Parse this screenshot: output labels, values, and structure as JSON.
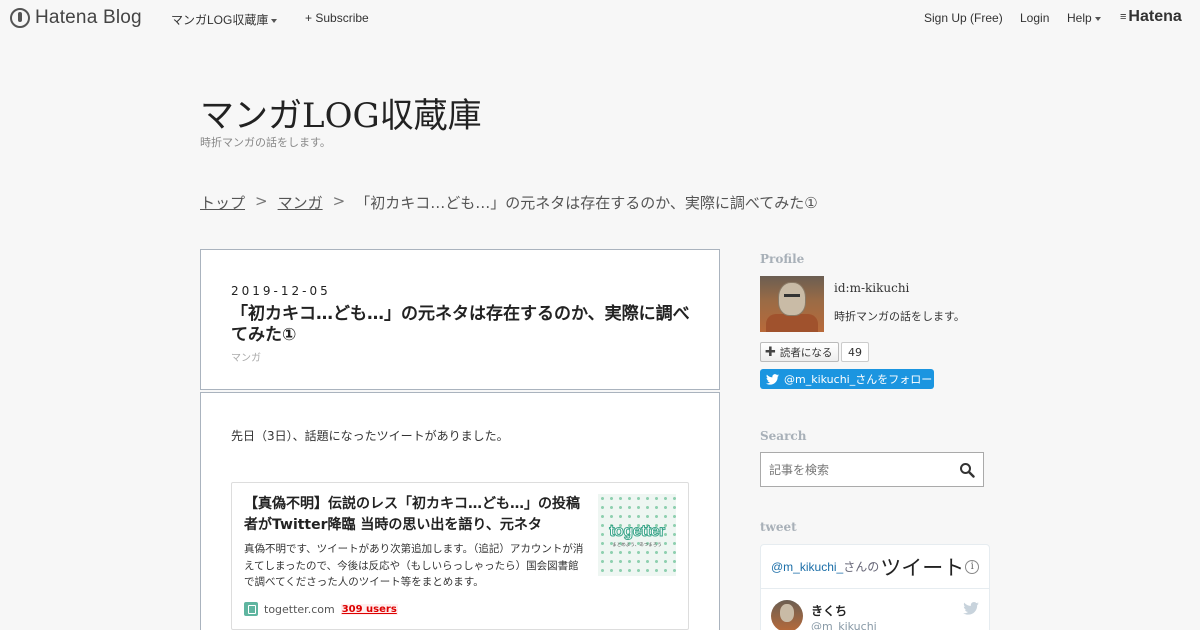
{
  "topbar": {
    "logo_text": "Hatena Blog",
    "blog_menu": "マンガLOG収蔵庫",
    "subscribe": "+ Subscribe",
    "signup": "Sign Up (Free)",
    "login": "Login",
    "help": "Help",
    "hatena": "Hatena"
  },
  "blog": {
    "title": "マンガLOG収蔵庫",
    "description": "時折マンガの話をします。"
  },
  "breadcrumb": {
    "top": "トップ",
    "sep1": ">",
    "category": "マンガ",
    "sep2": ">",
    "current": "「初カキコ…ども…」の元ネタは存在するのか、実際に調べてみた①"
  },
  "entry": {
    "date": "2019-12-05",
    "title": "「初カキコ…ども…」の元ネタは存在するのか、実際に調べてみた①",
    "category": "マンガ",
    "intro": "先日（3日）、話題になったツイートがありました。"
  },
  "embed": {
    "title": "【真偽不明】伝説のレス「初カキコ…ども…」の投稿者がTwitter降臨 当時の思い出を語り、元ネタ",
    "description": "真偽不明です、ツイートがあり次第追加します。（追記）アカウントが消えてしまったので、今後は反応や（もしいらっしゃったら）国会図書館で調べてくださった人のツイート等をまとめます。",
    "thumb_logo": "togetter",
    "thumb_sub": "まとめよう、あつまろう",
    "site": "togetter.com",
    "users": "309 users"
  },
  "sidebar": {
    "profile_heading": "Profile",
    "profile_id": "id:m-kikuchi",
    "profile_desc": "時折マンガの話をします。",
    "reader_button": "読者になる",
    "reader_count": "49",
    "follow_button": "@m_kikuchi_さんをフォロー",
    "search_heading": "Search",
    "search_placeholder": "記事を検索",
    "tweet_heading": "tweet",
    "tweet_handle": "@m_kikuchi_",
    "tweet_suffix": "さんの",
    "tweet_big": "ツイート",
    "tweet_name": "きくち",
    "tweet_user": "@m_kikuchi_"
  },
  "colors": {
    "twitter_blue": "#1b95e0",
    "users_red": "#dd0000",
    "border": "#aab3be"
  }
}
